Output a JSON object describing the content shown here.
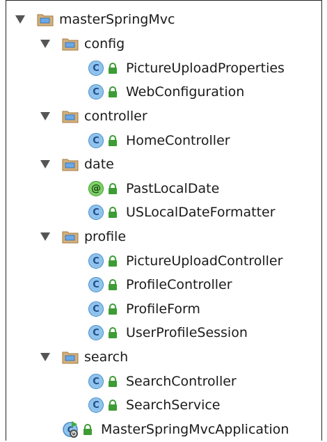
{
  "tree": {
    "root": {
      "label": "masterSpringMvc",
      "icon": "module-folder-icon"
    },
    "packages": [
      {
        "label": "config",
        "classes": [
          {
            "label": "PictureUploadProperties",
            "kind": "class"
          },
          {
            "label": "WebConfiguration",
            "kind": "class"
          }
        ]
      },
      {
        "label": "controller",
        "classes": [
          {
            "label": "HomeController",
            "kind": "class"
          }
        ]
      },
      {
        "label": "date",
        "classes": [
          {
            "label": "PastLocalDate",
            "kind": "annotation"
          },
          {
            "label": "USLocalDateFormatter",
            "kind": "class"
          }
        ]
      },
      {
        "label": "profile",
        "classes": [
          {
            "label": "PictureUploadController",
            "kind": "class"
          },
          {
            "label": "ProfileController",
            "kind": "class"
          },
          {
            "label": "ProfileForm",
            "kind": "class"
          },
          {
            "label": "UserProfileSession",
            "kind": "class"
          }
        ]
      },
      {
        "label": "search",
        "classes": [
          {
            "label": "SearchController",
            "kind": "class"
          },
          {
            "label": "SearchService",
            "kind": "class"
          }
        ]
      }
    ],
    "app_class": {
      "label": "MasterSpringMvcApplication",
      "icon": "spring-boot-run-icon"
    },
    "class_badge": "C",
    "annotation_badge": "@"
  },
  "colors": {
    "class_fill": "#8fc3ee",
    "annotation_fill": "#7ed167",
    "lock_green": "#3d9c35",
    "folder_tan": "#d5b07a"
  }
}
